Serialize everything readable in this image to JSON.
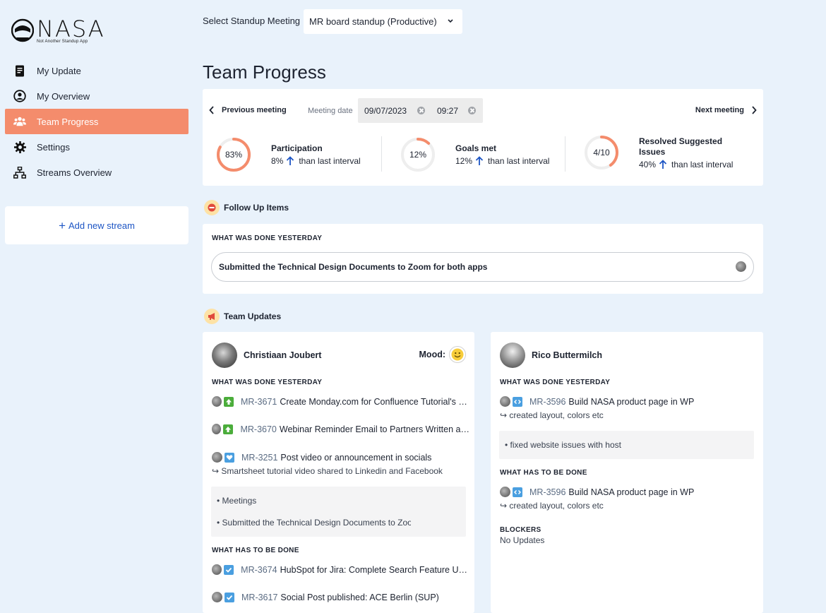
{
  "app": {
    "logo_word": "NASA",
    "logo_sub": "Not Another Standup App"
  },
  "sidebar": {
    "items": [
      {
        "label": "My Update",
        "icon": "document-icon"
      },
      {
        "label": "My Overview",
        "icon": "user-circle-icon"
      },
      {
        "label": "Team Progress",
        "icon": "users-icon",
        "active": true
      },
      {
        "label": "Settings",
        "icon": "gear-icon"
      },
      {
        "label": "Streams Overview",
        "icon": "hierarchy-icon"
      }
    ],
    "add_stream": "Add new stream"
  },
  "header": {
    "select_label": "Select Standup Meeting",
    "select_value": "MR board standup (Productive)",
    "title": "Team Progress"
  },
  "meeting": {
    "prev": "Previous meeting",
    "next": "Next meeting",
    "date_label": "Meeting date",
    "date": "09/07/2023",
    "time": "09:27"
  },
  "metrics": [
    {
      "value": "83%",
      "fraction": 0.83,
      "title": "Participation",
      "delta": "8%",
      "delta_text": "than last interval"
    },
    {
      "value": "12%",
      "fraction": 0.12,
      "title": "Goals met",
      "delta": "12%",
      "delta_text": "than last interval"
    },
    {
      "value": "4/10",
      "fraction": 0.4,
      "title": "Resolved Suggested Issues",
      "delta": "40%",
      "delta_text": "than last interval"
    }
  ],
  "follow_up": {
    "heading": "Follow Up Items",
    "caption": "WHAT WAS DONE YESTERDAY",
    "item": "Submitted the Technical Design Documents to Zoom for both apps"
  },
  "team_updates": {
    "heading": "Team Updates",
    "mood_label": "Mood:",
    "members": [
      {
        "name": "Christiaan Joubert",
        "yesterday_caption": "WHAT WAS DONE YESTERDAY",
        "yesterday": [
          {
            "key": "MR-3671",
            "title": "Create Monday.com for Confluence Tutorial's videos"
          },
          {
            "key": "MR-3670",
            "title": "Webinar Reminder Email to Partners Written and Sent"
          },
          {
            "key": "MR-3251",
            "title": "Post video or announcement in socials",
            "note": "Smartsheet tutorial video shared to Linkedin and Facebook"
          }
        ],
        "notes": [
          "Meetings",
          "Submitted the Technical Design Documents to Zoom for both apps"
        ],
        "todo_caption": "WHAT HAS TO BE DONE",
        "todo": [
          {
            "key": "MR-3674",
            "title": "HubSpot for Jira: Complete Search Feature Update"
          },
          {
            "key": "MR-3617",
            "title": "Social Post published: ACE Berlin (SUP)"
          }
        ]
      },
      {
        "name": "Rico Buttermilch",
        "yesterday_caption": "WHAT WAS DONE YESTERDAY",
        "yesterday": [
          {
            "key": "MR-3596",
            "title": "Build NASA product page in WP",
            "note": "created layout, colors etc"
          }
        ],
        "notes": [
          "fixed website issues with host"
        ],
        "todo_caption": "WHAT HAS TO BE DONE",
        "todo": [
          {
            "key": "MR-3596",
            "title": "Build NASA product page in WP",
            "note": "created layout, colors etc"
          }
        ],
        "blockers_caption": "BLOCKERS",
        "blockers": "No Updates"
      }
    ]
  },
  "colors": {
    "accent": "#f48c6c",
    "link": "#1d55c4",
    "story": "#4bad3b",
    "task": "#4a9fe0",
    "code": "#4a9fe0"
  }
}
